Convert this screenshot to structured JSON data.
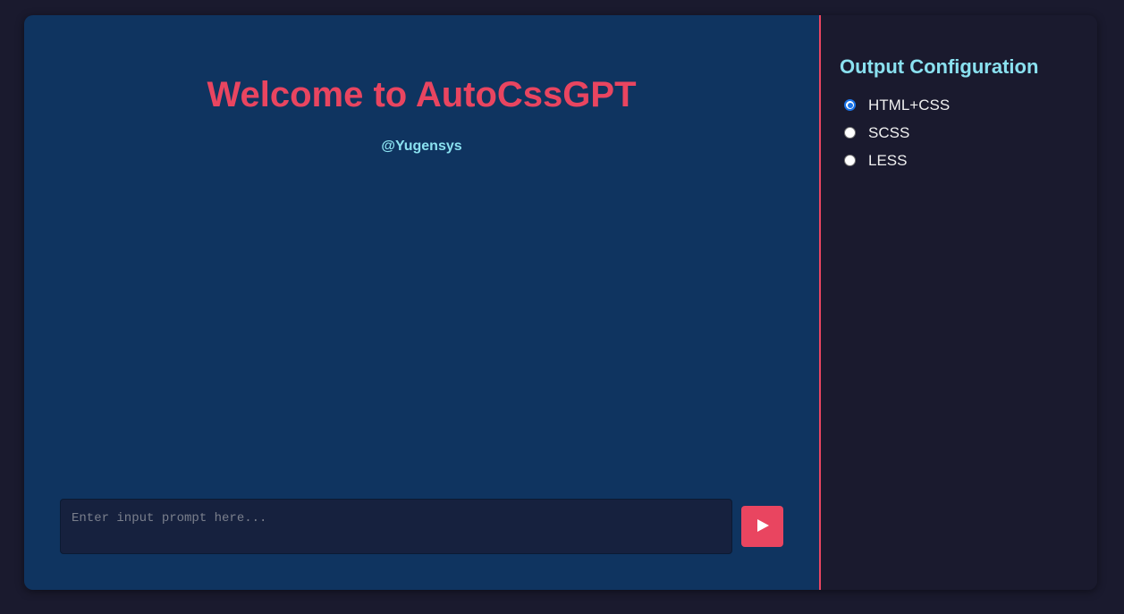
{
  "main": {
    "title": "Welcome to AutoCssGPT",
    "subtitle": "@Yugensys",
    "prompt": {
      "placeholder": "Enter input prompt here...",
      "value": ""
    },
    "send_icon": "play-icon"
  },
  "sidebar": {
    "title": "Output Configuration",
    "selected": "HTML+CSS",
    "options": [
      {
        "label": "HTML+CSS",
        "checked": true
      },
      {
        "label": "SCSS",
        "checked": false
      },
      {
        "label": "LESS",
        "checked": false
      }
    ]
  },
  "colors": {
    "page_background": "#1a1a2e",
    "main_background": "#0f3460",
    "accent": "#e94560",
    "subtitle": "#8ae1f0",
    "input_background": "#16213e"
  }
}
